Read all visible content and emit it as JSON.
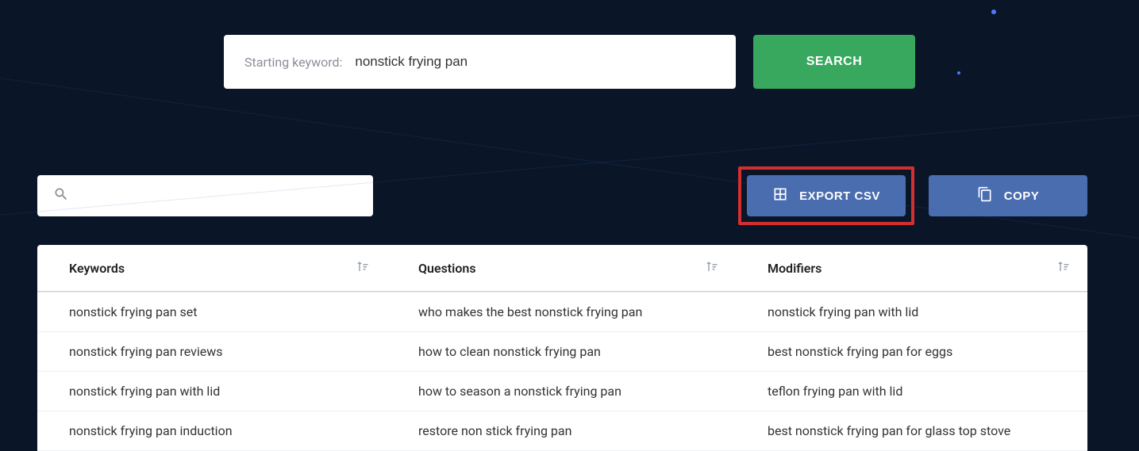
{
  "search": {
    "label": "Starting keyword:",
    "value": "nonstick frying pan",
    "button_label": "SEARCH"
  },
  "filter": {
    "placeholder": ""
  },
  "actions": {
    "export_label": "EXPORT CSV",
    "copy_label": "COPY"
  },
  "columns": {
    "keywords": {
      "header": "Keywords",
      "rows": [
        "nonstick frying pan set",
        "nonstick frying pan reviews",
        "nonstick frying pan with lid",
        "nonstick frying pan induction"
      ]
    },
    "questions": {
      "header": "Questions",
      "rows": [
        "who makes the best nonstick frying pan",
        "how to clean nonstick frying pan",
        "how to season a nonstick frying pan",
        "restore non stick frying pan"
      ]
    },
    "modifiers": {
      "header": "Modifiers",
      "rows": [
        "nonstick frying pan with lid",
        "best nonstick frying pan for eggs",
        "teflon frying pan with lid",
        "best nonstick frying pan for glass top stove"
      ]
    }
  }
}
